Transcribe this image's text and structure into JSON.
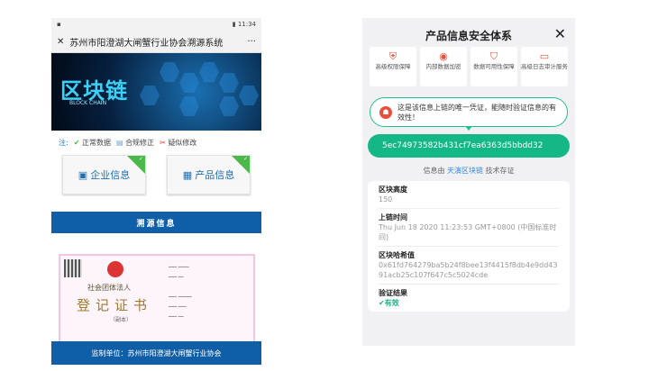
{
  "left": {
    "status": {
      "time": "11:34"
    },
    "title": "苏州市阳澄湖大闸蟹行业协会溯源系统",
    "more": "···",
    "close": "✕",
    "banner": {
      "title": "区块链",
      "subtitle": "BLOCK CHAIN"
    },
    "legend": {
      "note": "注:",
      "normal": "正常数据",
      "compliant": "合规修正",
      "suspect": "疑似修改"
    },
    "cards": [
      {
        "label": "企业信息",
        "icon": "building-icon"
      },
      {
        "label": "产品信息",
        "icon": "grid-icon"
      }
    ],
    "trace_button": "溯源信息",
    "certificate": {
      "line1": "社会团体法人",
      "line2": "登记证书",
      "line3": "（副本）"
    },
    "footer": "监制单位：苏州市阳澄湖大闸蟹行业协会"
  },
  "right": {
    "title": "产品信息安全体系",
    "close": "✕",
    "features": [
      {
        "icon": "key-shield-icon",
        "label": "高级权限保障"
      },
      {
        "icon": "eye-shield-icon",
        "label": "内部数据加密"
      },
      {
        "icon": "check-shield-icon",
        "label": "数据可用性保障"
      },
      {
        "icon": "log-icon",
        "label": "高级日志审计服务"
      }
    ],
    "bubble": "这是该信息上链的唯一凭证，能随时验证信息的有效性！",
    "tx_hash": "5ec74973582b431cf7ea6363d5bbdd32",
    "provider": {
      "prefix": "信息由",
      "link": "天演区块链",
      "suffix": "技术存证"
    },
    "rows": [
      {
        "key": "区块高度",
        "value": "150"
      },
      {
        "key": "上链时间",
        "value": "Thu Jun 18 2020 11:23:53 GMT+0800 (中国标准时间)"
      },
      {
        "key": "区块哈希值",
        "value": "0x61fd764279ba5b24f8bee13f4415f8db4e9dd4391acb25c107f647c5c5024cde"
      }
    ],
    "verify": {
      "key": "验证结果",
      "value": "有效"
    }
  }
}
